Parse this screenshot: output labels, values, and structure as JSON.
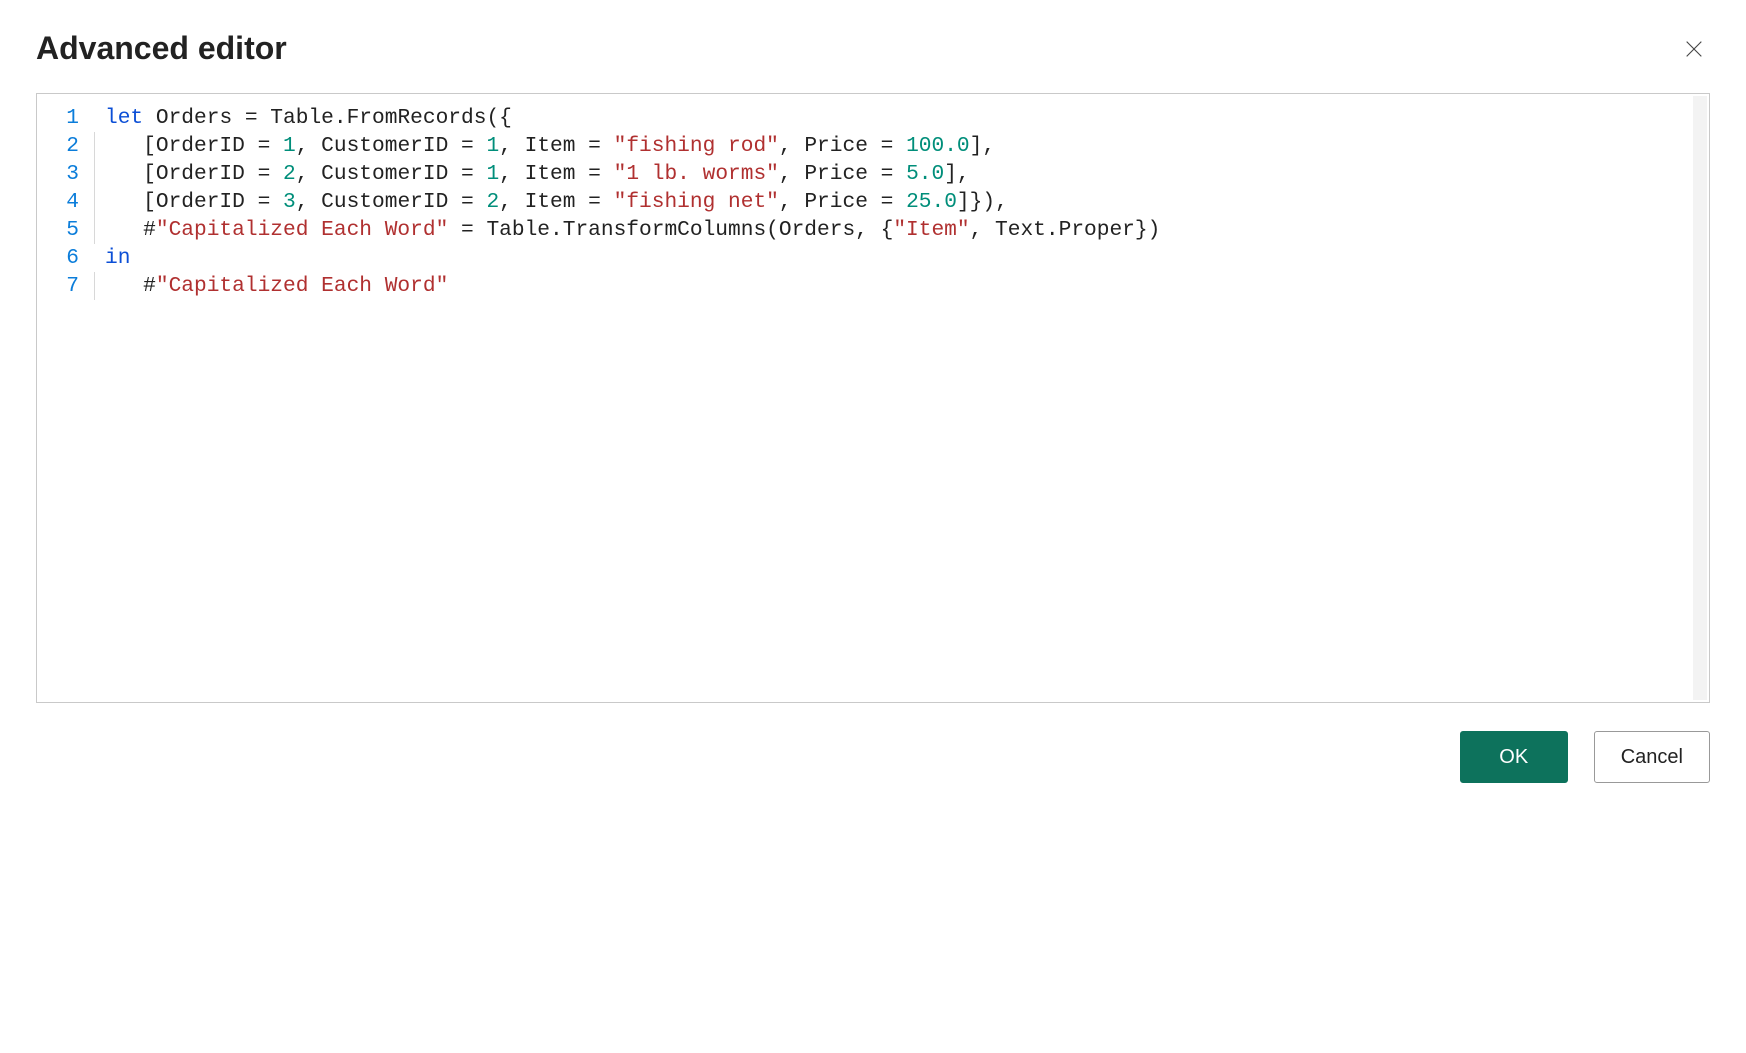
{
  "header": {
    "title": "Advanced editor",
    "close_icon": "close-icon"
  },
  "editor": {
    "lines": [
      {
        "num": "1",
        "indent": "none",
        "tokens": [
          {
            "cls": "kw",
            "t": "let"
          },
          {
            "cls": "",
            "t": " Orders = Table.FromRecords({"
          }
        ]
      },
      {
        "num": "2",
        "indent": "guide",
        "tokens": [
          {
            "cls": "",
            "t": "   [OrderID = "
          },
          {
            "cls": "num",
            "t": "1"
          },
          {
            "cls": "",
            "t": ", CustomerID = "
          },
          {
            "cls": "num",
            "t": "1"
          },
          {
            "cls": "",
            "t": ", Item = "
          },
          {
            "cls": "str",
            "t": "\"fishing rod\""
          },
          {
            "cls": "",
            "t": ", Price = "
          },
          {
            "cls": "num",
            "t": "100.0"
          },
          {
            "cls": "",
            "t": "],"
          }
        ]
      },
      {
        "num": "3",
        "indent": "guide",
        "tokens": [
          {
            "cls": "",
            "t": "   [OrderID = "
          },
          {
            "cls": "num",
            "t": "2"
          },
          {
            "cls": "",
            "t": ", CustomerID = "
          },
          {
            "cls": "num",
            "t": "1"
          },
          {
            "cls": "",
            "t": ", Item = "
          },
          {
            "cls": "str",
            "t": "\"1 lb. worms\""
          },
          {
            "cls": "",
            "t": ", Price = "
          },
          {
            "cls": "num",
            "t": "5.0"
          },
          {
            "cls": "",
            "t": "],"
          }
        ]
      },
      {
        "num": "4",
        "indent": "guide",
        "tokens": [
          {
            "cls": "",
            "t": "   [OrderID = "
          },
          {
            "cls": "num",
            "t": "3"
          },
          {
            "cls": "",
            "t": ", CustomerID = "
          },
          {
            "cls": "num",
            "t": "2"
          },
          {
            "cls": "",
            "t": ", Item = "
          },
          {
            "cls": "str",
            "t": "\"fishing net\""
          },
          {
            "cls": "",
            "t": ", Price = "
          },
          {
            "cls": "num",
            "t": "25.0"
          },
          {
            "cls": "",
            "t": "]}),"
          }
        ]
      },
      {
        "num": "5",
        "indent": "guide",
        "tokens": [
          {
            "cls": "",
            "t": "   #"
          },
          {
            "cls": "str",
            "t": "\"Capitalized Each Word\""
          },
          {
            "cls": "",
            "t": " = Table.TransformColumns(Orders, {"
          },
          {
            "cls": "str",
            "t": "\"Item\""
          },
          {
            "cls": "",
            "t": ", Text.Proper})"
          }
        ]
      },
      {
        "num": "6",
        "indent": "none",
        "tokens": [
          {
            "cls": "kw",
            "t": "in"
          }
        ]
      },
      {
        "num": "7",
        "indent": "guide",
        "tokens": [
          {
            "cls": "",
            "t": "   #"
          },
          {
            "cls": "str",
            "t": "\"Capitalized Each Word\""
          }
        ]
      }
    ]
  },
  "footer": {
    "ok_label": "OK",
    "cancel_label": "Cancel"
  },
  "colors": {
    "primary": "#0d725c"
  }
}
